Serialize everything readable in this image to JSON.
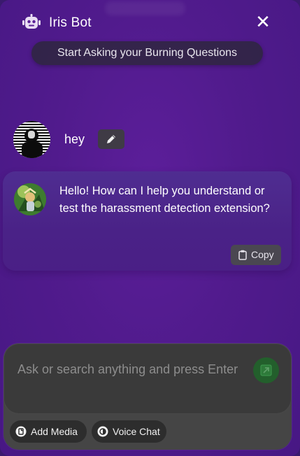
{
  "header": {
    "title": "Iris Bot",
    "bot_icon": "robot-icon",
    "close_icon": "close-icon",
    "close_glyph": "✕"
  },
  "subtitle": "Start Asking your Burning Questions",
  "conversation": {
    "user_message": {
      "avatar": "user-avatar",
      "text": "hey",
      "edit_icon": "pencil-icon"
    },
    "bot_message": {
      "avatar": "bot-avatar",
      "text": "Hello! How can I help you understand or test the harassment detection extension?",
      "copy_label": "Copy",
      "copy_icon": "clipboard-icon"
    }
  },
  "composer": {
    "placeholder": "Ask or search anything and press Enter",
    "value": "",
    "send_icon": "send-arrow-icon",
    "actions": [
      {
        "label": "Add Media",
        "icon": "media-icon"
      },
      {
        "label": "Voice Chat",
        "icon": "voice-icon"
      }
    ]
  },
  "colors": {
    "background": "#511b8d",
    "card": "#4f2d91",
    "composer": "#454545",
    "send_button": "#235f2c",
    "text": "#ffffff"
  }
}
